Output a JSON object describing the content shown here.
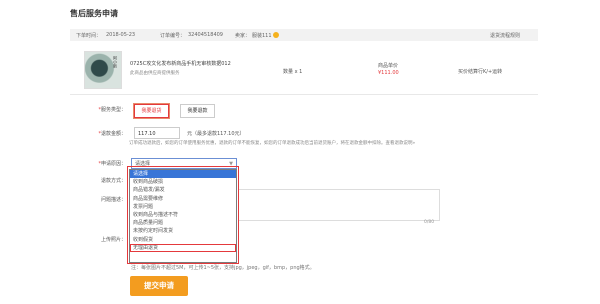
{
  "page": {
    "title": "售后服务申请"
  },
  "order": {
    "date_label": "下单时间：",
    "date_value": "2018-05-23",
    "number_label": "订单编号：",
    "number_value": "32404518409",
    "seller_label": "卖家：",
    "seller_value": "服装111",
    "contact_link": "退货流程规则"
  },
  "product": {
    "thumb_text": "阿小新",
    "name": "0725C攻文化发布新商品手机无审核数据012",
    "note": "此商品由供应商提供服务",
    "quantity": "数量 x 1",
    "price_label": "商品单价",
    "price_value": "¥111.00",
    "extra": "买价结算行K/+运转"
  },
  "form": {
    "service_type_label": "服务类型：",
    "service_types": [
      "我要退货",
      "我要退款"
    ],
    "amount_label": "退款金额：",
    "amount_value": "117.10",
    "amount_note": "元（最多退款117.10元）",
    "warning": "订单成功退款后，如您的订单使用服务优惠，退款的订单不能恢复，如您的订单退款成功后当前退货账户，将在退款金额中扣除。查看退款说明»",
    "reason_label": "申请原因：",
    "reason_placeholder": "请选择",
    "refund_method_label": "退款方式：",
    "problem_label": "问题描述：",
    "upload_label": "上传照片：",
    "counter": "0/80",
    "upload_hint": "注：每张图片不超过5M，可上传1~5张，支持jpg，jpeg，gif，bmp，png格式。",
    "submit_label": "提交申请"
  },
  "reasons": [
    "请选择",
    "收到商品破损",
    "商品错发/漏发",
    "商品需要维修",
    "发票问题",
    "收到商品与描述不符",
    "商品质量问题",
    "未按约定时间发货",
    "收到假货",
    "无理由退货"
  ],
  "colors": {
    "accent": "#e4393c",
    "submit": "#f39c1f",
    "select_highlight": "#3875d7"
  }
}
